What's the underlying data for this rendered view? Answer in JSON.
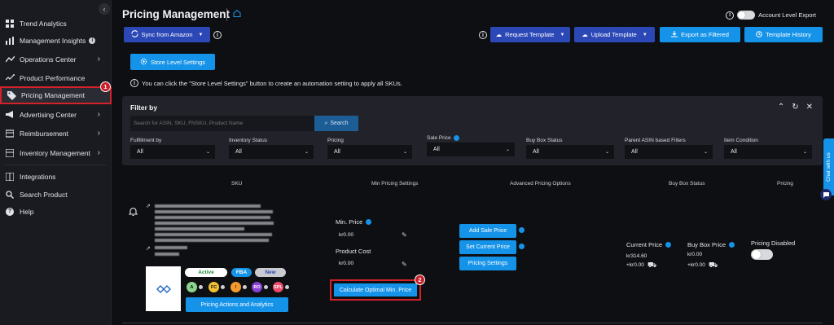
{
  "sidebar": {
    "items": [
      {
        "label": "Trend Analytics",
        "icon": "trend-analytics-icon"
      },
      {
        "label": "Management Insights",
        "icon": "bar-chart-icon"
      },
      {
        "label": "Operations Center",
        "icon": "line-chart-icon"
      },
      {
        "label": "Product Performance",
        "icon": "performance-icon"
      },
      {
        "label": "Pricing Management",
        "icon": "price-tag-icon"
      },
      {
        "label": "Advertising Center",
        "icon": "megaphone-icon"
      },
      {
        "label": "Reimbursement",
        "icon": "reimbursement-icon"
      },
      {
        "label": "Inventory Management",
        "icon": "inventory-icon"
      },
      {
        "label": "Integrations",
        "icon": "grid-icon"
      },
      {
        "label": "Search Product",
        "icon": "search-icon"
      },
      {
        "label": "Help",
        "icon": "help-icon"
      }
    ],
    "step_badge": "1"
  },
  "header": {
    "title": "Pricing Management",
    "account_export_label": "Account Level Export"
  },
  "toolbar": {
    "sync_label": "Sync from Amazon",
    "request_template": "Request Template",
    "upload_template": "Upload Template",
    "export_filtered": "Export as Filtered",
    "template_history": "Template History",
    "store_settings": "Store Level Settings",
    "hint": "You can click the \"Store Level Settings\" button to create an automation setting to apply all SKUs."
  },
  "filter": {
    "title": "Filter by",
    "search_placeholder": "Search for ASIN, SKU, FNSKU, Product Name",
    "search_button": "Search",
    "fields": [
      {
        "label": "Fulfillment by",
        "value": "All"
      },
      {
        "label": "Inventory Status",
        "value": "All"
      },
      {
        "label": "Pricing",
        "value": "All"
      },
      {
        "label": "Sale Price",
        "value": "All"
      },
      {
        "label": "Buy Box Status",
        "value": "All"
      },
      {
        "label": "Parent ASIN based Filters",
        "value": "All"
      },
      {
        "label": "Item Condition",
        "value": "All"
      }
    ]
  },
  "table": {
    "headers": [
      "SKU",
      "Min Pricing Settings",
      "Advanced Pricing Options",
      "Buy Box Status",
      "Pricing"
    ]
  },
  "row": {
    "status_active": "Active",
    "status_fba": "FBA",
    "status_new": "New",
    "circles": [
      "A",
      "FC",
      "!",
      "RO",
      "SPL"
    ],
    "pricing_actions": "Pricing Actions and Analytics",
    "min_price_label": "Min. Price",
    "min_price_value": "kr0.00",
    "product_cost_label": "Product Cost",
    "product_cost_value": "kr0.00",
    "calc_button": "Calculate Optimal Min. Price",
    "step_badge": "2",
    "add_sale_price": "Add Sale Price",
    "set_current_price": "Set Current Price",
    "pricing_settings": "Pricing Settings",
    "current_price_label": "Current Price",
    "current_price_value": "kr314.60",
    "current_shipping": "+kr0.00",
    "buybox_price_label": "Buy Box Price",
    "buybox_price_value": "kr0.00",
    "buybox_shipping": "+kr0.00",
    "pricing_disabled": "Pricing Disabled"
  },
  "chat": {
    "label": "Chat with us"
  },
  "colors": {
    "accent_blue": "#1593e8",
    "dark_blue": "#2b48b6",
    "highlight_red": "#d6202a"
  }
}
